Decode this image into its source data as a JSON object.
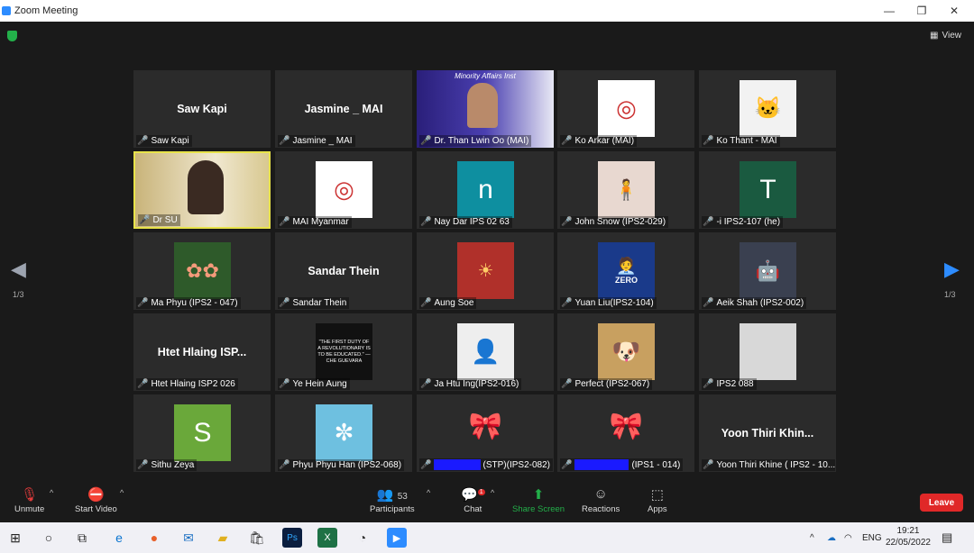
{
  "window": {
    "title": "Zoom Meeting",
    "minimize": "—",
    "maximize": "❐",
    "close": "✕"
  },
  "view_label": "View",
  "paging": {
    "left": "1/3",
    "right": "1/3"
  },
  "participants": [
    {
      "name": "Saw Kapi",
      "big": "Saw Kapi"
    },
    {
      "name": "Jasmine _ MAI",
      "big": "Jasmine _ MAI"
    },
    {
      "name": "Dr. Than Lwin Oo (MAI)",
      "big": "Minority Affairs Inst"
    },
    {
      "name": "Ko Arkar (MAI)",
      "big": ""
    },
    {
      "name": "Ko Thant - MAI",
      "big": ""
    },
    {
      "name": "Dr SU",
      "big": ""
    },
    {
      "name": "MAI Myanmar",
      "big": ""
    },
    {
      "name": "Nay Dar IPS 02 63",
      "big": "n"
    },
    {
      "name": "John Snow (IPS2-029)",
      "big": ""
    },
    {
      "name": "-i IPS2-107 (he)",
      "big": "T"
    },
    {
      "name": "Ma Phyu (IPS2 - 047)",
      "big": ""
    },
    {
      "name": "Sandar Thein",
      "big": "Sandar Thein"
    },
    {
      "name": "Aung Soe",
      "big": ""
    },
    {
      "name": "Yuan Liu(IPS2-104)",
      "big": "ZERO"
    },
    {
      "name": "Aeik Shah (IPS2-002)",
      "big": ""
    },
    {
      "name": "Htet Hlaing ISP2 026",
      "big": "Htet  Hlaing  ISP..."
    },
    {
      "name": "Ye Hein Aung",
      "big": "\"THE FIRST DUTY OF A REVOLUTIONARY IS TO BE EDUCATED.\" — CHE GUEVARA"
    },
    {
      "name": "Ja Htu Ing(IPS2-016)",
      "big": ""
    },
    {
      "name": "Perfect (IPS2-067)",
      "big": ""
    },
    {
      "name": "IPS2 088",
      "big": ""
    },
    {
      "name": "Sithu Zeya",
      "big": "S"
    },
    {
      "name": "Phyu Phyu Han (IPS2-068)",
      "big": ""
    },
    {
      "name": "(STP)(IPS2-082)",
      "big": ""
    },
    {
      "name": "(IPS1 - 014)",
      "big": ""
    },
    {
      "name": "Yoon Thiri Khine ( IPS2 - 10...",
      "big": "Yoon  Thiri  Khin..."
    }
  ],
  "toolbar": {
    "unmute": "Unmute",
    "start_video": "Start Video",
    "participants": "Participants",
    "participants_count": "53",
    "chat": "Chat",
    "chat_badge": "1",
    "share_screen": "Share Screen",
    "reactions": "Reactions",
    "apps": "Apps",
    "leave": "Leave"
  },
  "taskbar": {
    "lang": "ENG",
    "time": "19:21",
    "date": "22/05/2022"
  },
  "colors": {
    "active_border": "#e8e34a",
    "share_green": "#23b04a",
    "leave_red": "#e02828",
    "arrow_blue": "#2d8cff"
  }
}
